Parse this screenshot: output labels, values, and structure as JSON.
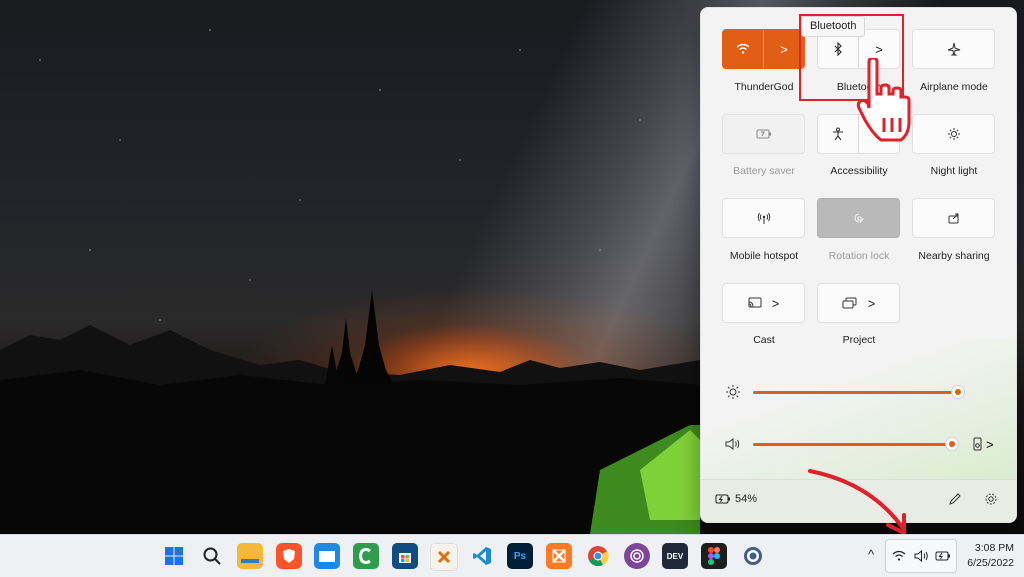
{
  "quick_settings": {
    "tiles": [
      {
        "id": "wifi",
        "label": "ThunderGod",
        "state": "on",
        "split": true
      },
      {
        "id": "bluetooth",
        "label": "Bluetooth",
        "state": "off",
        "split": true
      },
      {
        "id": "airplane",
        "label": "Airplane mode",
        "state": "off",
        "split": false
      },
      {
        "id": "battery-saver",
        "label": "Battery saver",
        "state": "disabled",
        "split": false
      },
      {
        "id": "accessibility",
        "label": "Accessibility",
        "state": "off",
        "split": true
      },
      {
        "id": "night-light",
        "label": "Night light",
        "state": "off",
        "split": false
      },
      {
        "id": "mobile-hotspot",
        "label": "Mobile hotspot",
        "state": "off",
        "split": false
      },
      {
        "id": "rotation-lock",
        "label": "Rotation lock",
        "state": "disabled",
        "split": false
      },
      {
        "id": "nearby-sharing",
        "label": "Nearby sharing",
        "state": "off",
        "split": false
      },
      {
        "id": "cast",
        "label": "Cast",
        "state": "off",
        "split": true
      },
      {
        "id": "project",
        "label": "Project",
        "state": "off",
        "split": true
      }
    ],
    "brightness_level": 1.0,
    "volume_level": 0.97,
    "battery_percent": "54%",
    "chevron": ">",
    "tooltip": "Bluetooth"
  },
  "taskbar": {
    "apps": [
      "start",
      "search",
      "file-explorer",
      "brave",
      "microsoft-store-alt",
      "camtasia",
      "app-store",
      "xampp-cp",
      "vscode",
      "photoshop",
      "xampp",
      "chrome",
      "tor-browser",
      "devdocs",
      "figma",
      "obs"
    ],
    "overflow_chevron": "^",
    "time": "3:08 PM",
    "date": "6/25/2022"
  },
  "colors": {
    "accent": "#e05f14",
    "annotation": "#e0202a"
  }
}
